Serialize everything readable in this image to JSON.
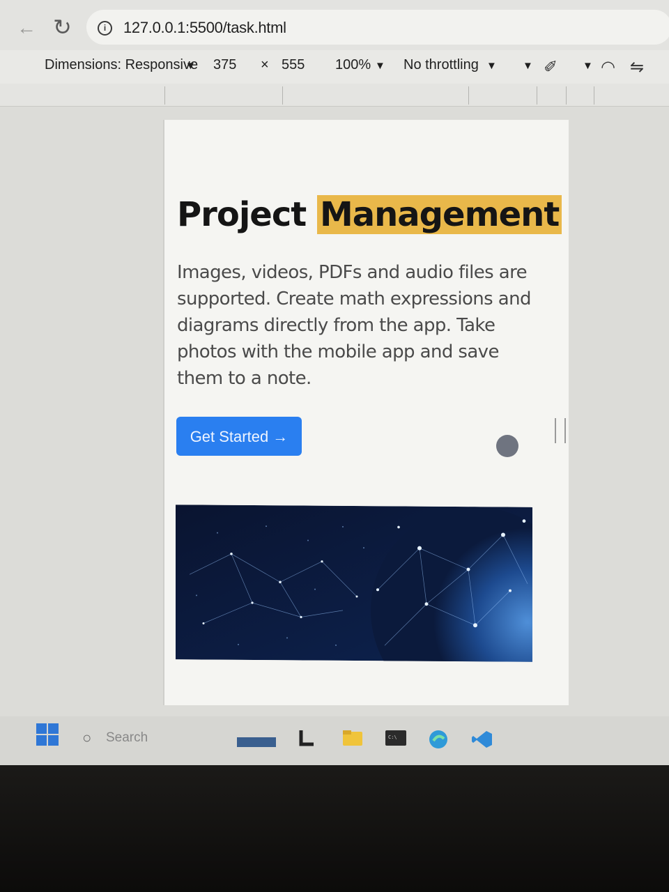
{
  "browser": {
    "url": "127.0.0.1:5500/task.html"
  },
  "devtools": {
    "dimensions_label": "Dimensions: Responsive",
    "width_value": "375",
    "height_prefix": "×",
    "height_value": "555",
    "zoom": "100%",
    "throttling": "No throttling"
  },
  "page": {
    "title_part1": "Project",
    "title_part2": "Management",
    "description": "Images, videos, PDFs and audio files are supported. Create math expressions and diagrams directly from the app. Take photos with the mobile app and save them to a note.",
    "cta_label": "Get Started →"
  },
  "taskbar": {
    "search_placeholder": "Search"
  },
  "colors": {
    "accent": "#2a7ff0",
    "highlight": "#e9b84a"
  }
}
